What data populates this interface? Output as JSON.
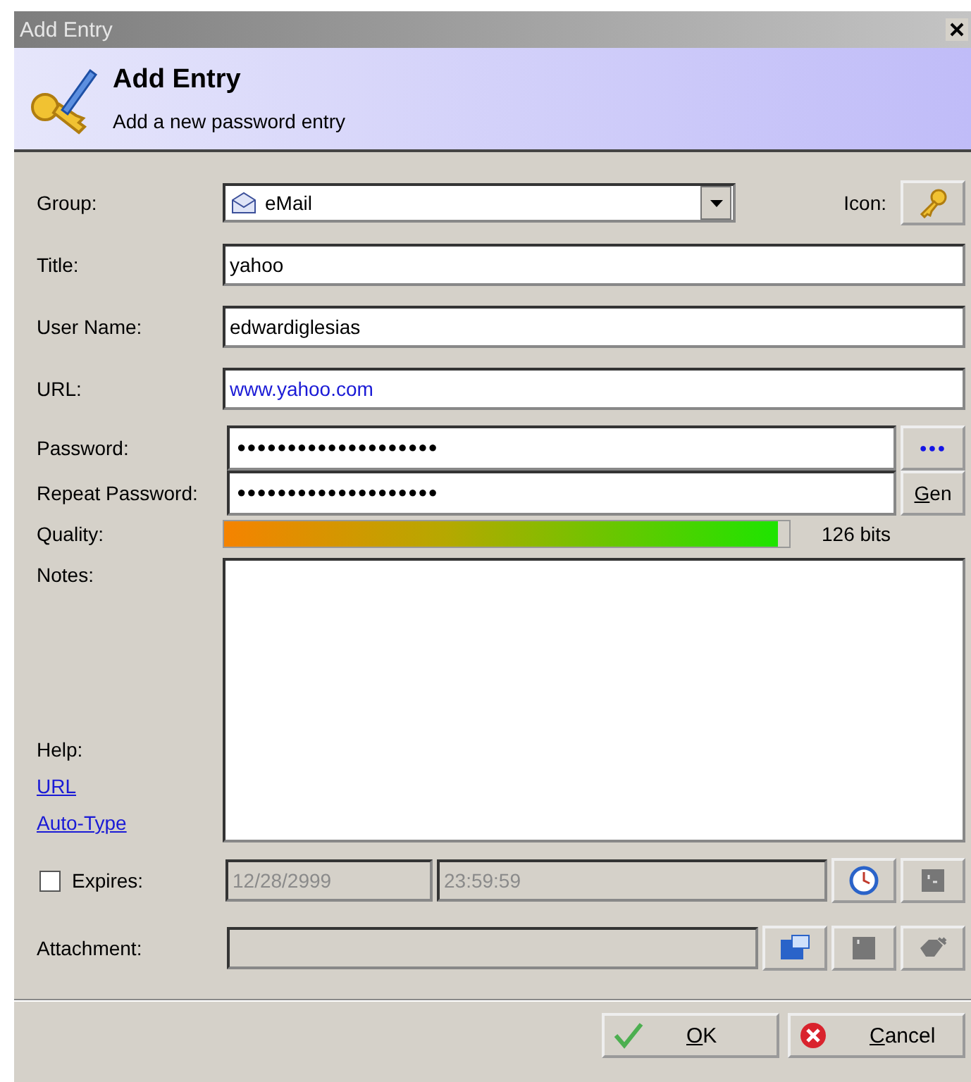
{
  "window": {
    "title": "Add Entry"
  },
  "header": {
    "title": "Add Entry",
    "subtitle": "Add a new password entry"
  },
  "group": {
    "label": "Group:",
    "value": "eMail",
    "icon_label": "Icon:"
  },
  "text_fields": [
    {
      "label": "Title:",
      "value": "yahoo",
      "kind": "text"
    },
    {
      "label": "User Name:",
      "value": "edwardiglesias",
      "kind": "text"
    },
    {
      "label": "URL:",
      "value": "www.yahoo.com",
      "kind": "link"
    }
  ],
  "password": {
    "label": "Password:",
    "value": "●●●●●●●●●●●●●●●●●●●●",
    "button": "●●●"
  },
  "repeat_password": {
    "label": "Repeat Password:",
    "value": "●●●●●●●●●●●●●●●●●●●●",
    "button": "Gen",
    "mnemonic_first": true
  },
  "quality": {
    "label": "Quality:",
    "level": 0.98,
    "reading": "126 bits"
  },
  "notes": {
    "label": "Notes:"
  },
  "help": {
    "label": "Help:",
    "links": [
      "URL",
      "Auto-Type"
    ]
  },
  "expires": {
    "label": "Expires:",
    "checked": false,
    "date": "12/28/2999",
    "time": "23:59:59",
    "disabled": true
  },
  "attachment": {
    "label": "Attachment:"
  },
  "buttons": [
    {
      "label": "OK",
      "kind": "ok",
      "mnemonic_first": true
    },
    {
      "label": "Cancel",
      "kind": "cancel",
      "mnemonic_first": true
    }
  ]
}
